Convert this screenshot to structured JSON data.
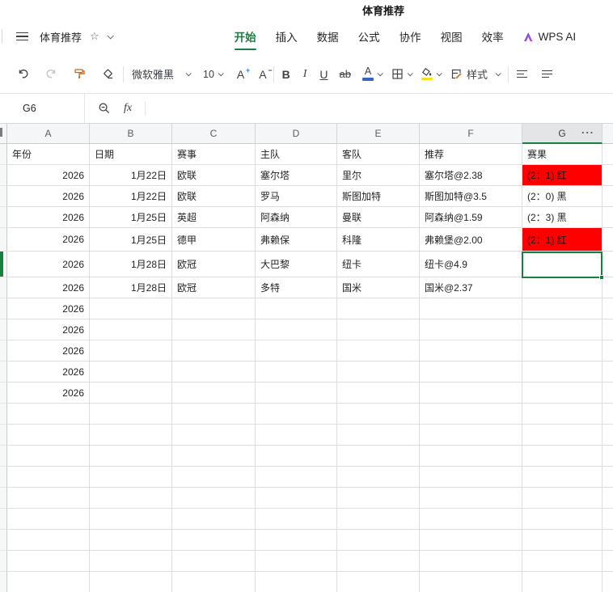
{
  "title": "体育推荐",
  "menu": {
    "doc_name": "体育推荐",
    "tabs": [
      {
        "label": "开始",
        "active": true
      },
      {
        "label": "插入"
      },
      {
        "label": "数据"
      },
      {
        "label": "公式"
      },
      {
        "label": "协作"
      },
      {
        "label": "视图"
      },
      {
        "label": "效率"
      },
      {
        "label": "WPS AI"
      }
    ]
  },
  "toolbar": {
    "font_name": "微软雅黑",
    "font_size": "10",
    "increase_font_letter": "A",
    "decrease_font_letter": "A",
    "bold": "B",
    "italic": "I",
    "underline": "U",
    "strikethrough": "ab",
    "font_color_letter": "A",
    "style_label": "样式"
  },
  "formula_bar": {
    "cell_ref": "G6",
    "fx_label": "fx"
  },
  "sheet": {
    "column_headers": [
      "A",
      "B",
      "C",
      "D",
      "E",
      "F",
      "G"
    ],
    "more_button": "···",
    "active_column": "G",
    "active_cell": "G6",
    "table_headers": [
      "年份",
      "日期",
      "赛事",
      "主队",
      "客队",
      "推荐",
      "赛果"
    ],
    "rows": [
      {
        "year": "2026",
        "date": "1月22日",
        "league": "欧联",
        "home": "塞尔塔",
        "away": "里尔",
        "tip": "塞尔塔@2.38",
        "result": "(2：1) 红",
        "result_highlight": "red"
      },
      {
        "year": "2026",
        "date": "1月22日",
        "league": "欧联",
        "home": "罗马",
        "away": "斯图加特",
        "tip": "斯图加特@3.5",
        "result": "(2：0) 黑"
      },
      {
        "year": "2026",
        "date": "1月25日",
        "league": "英超",
        "home": "阿森纳",
        "away": "曼联",
        "tip": "阿森纳@1.59",
        "result": "(2：3) 黑"
      },
      {
        "year": "2026",
        "date": "1月25日",
        "league": "德甲",
        "home": "弗赖保",
        "away": "科隆",
        "tip": "弗赖堡@2.00",
        "result": "(2：1) 红",
        "result_highlight": "red"
      },
      {
        "year": "2026",
        "date": "1月28日",
        "league": "欧冠",
        "home": "大巴黎",
        "away": "纽卡",
        "tip": "纽卡@4.9",
        "selected": true
      },
      {
        "year": "2026",
        "date": "1月28日",
        "league": "欧冠",
        "home": "多特",
        "away": "国米",
        "tip": "国米@2.37"
      },
      {
        "year": "2026"
      },
      {
        "year": "2026"
      },
      {
        "year": "2026"
      },
      {
        "year": "2026"
      },
      {
        "year": "2026"
      }
    ]
  },
  "colors": {
    "accent_green": "#1b7e41",
    "result_red": "#fe0000",
    "font_color_blue": "#3567c2",
    "fill_color_yellow": "#f5e11c"
  }
}
